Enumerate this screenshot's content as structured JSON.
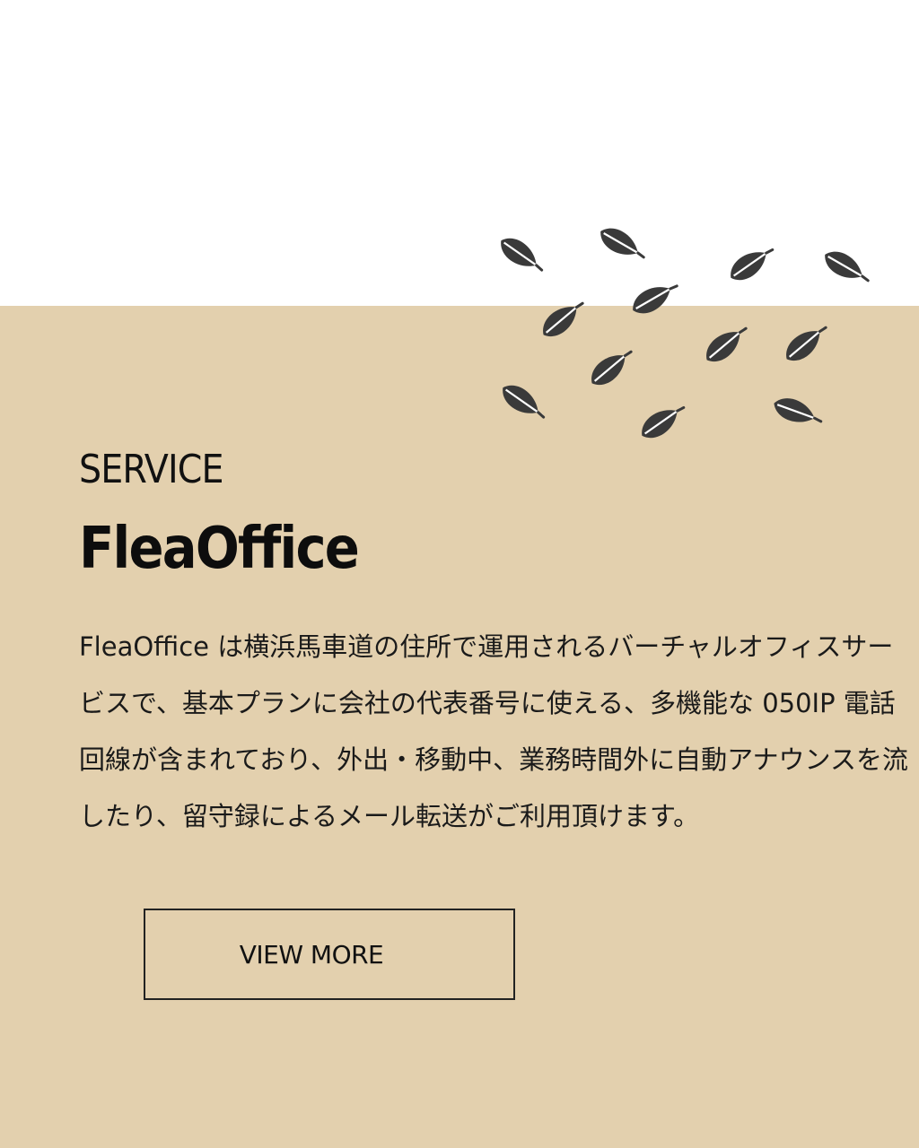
{
  "section": {
    "eyebrow": "SERVICE",
    "title": "FleaOffice",
    "description_lines": [
      "FleaOffice は横浜馬車道の住所で運用されるバーチャルオフィスサー",
      "ビスで、基本プランに会社の代表番号に使える、多機能な 050IP 電話",
      "回線が含まれており、外出・移動中、業務時間外に自動アナウンスを流",
      "したり、留守録によるメール転送がご利用頂けます。"
    ],
    "button_label": "VIEW MORE"
  },
  "colors": {
    "background_top": "#ffffff",
    "background_beige": "#e3d0ae",
    "leaf": "#3a3a3a",
    "text": "#111111"
  },
  "decoration": {
    "icon": "leaf-icon",
    "leaf_count": 13
  }
}
